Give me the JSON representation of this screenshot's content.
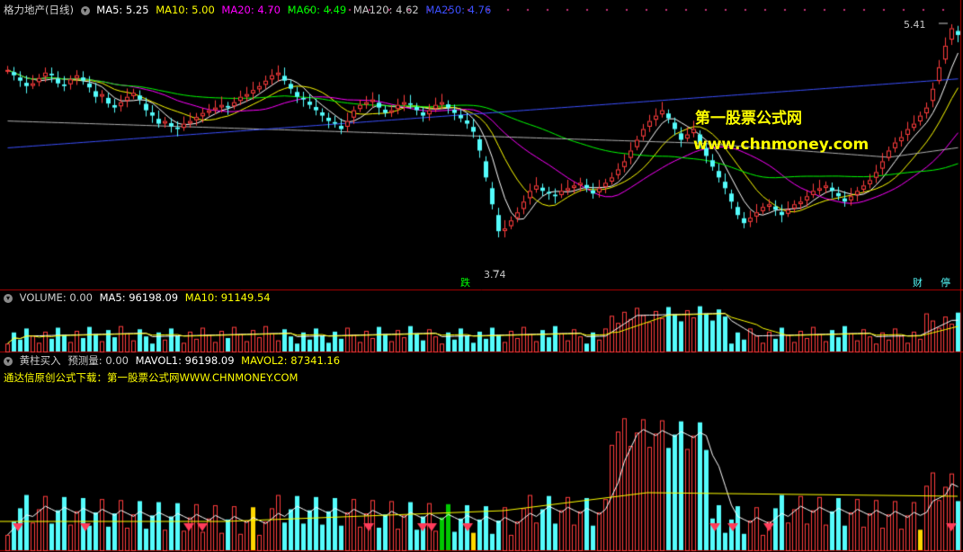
{
  "colors": {
    "up": "#ff3c3c",
    "down": "#54fcfc",
    "ma5": "#ffffff",
    "ma10": "#ffff00",
    "ma20": "#ff00ff",
    "ma60": "#00ff00",
    "ma120": "#b0b0b0",
    "ma250": "#3c50ff",
    "separator": "#b40000",
    "yellow_bar": "#ffd700",
    "green_bar": "#00c800"
  },
  "main_header": {
    "title": "格力地产(日线)",
    "ma5": "MA5: 5.25",
    "ma10": "MA10: 5.00",
    "ma20": "MA20: 4.70",
    "ma60": "MA60: 4.49",
    "ma120": "MA120: 4.62",
    "ma250": "MA250: 4.76"
  },
  "volume_header": {
    "title": "VOLUME: 0.00",
    "ma5": "MA5: 96198.09",
    "ma10": "MA10: 91149.54"
  },
  "ind_header": {
    "title": "黄柱买入",
    "forecast": "预测量: 0.00",
    "mavol1": "MAVOL1: 96198.09",
    "mavol2": "MAVOL2: 87341.16",
    "note": "通达信原创公式下载：第一股票公式网WWW.CHNMONEY.COM"
  },
  "watermark": {
    "line1": "第一股票公式网",
    "line2": "www.chnmoney.com"
  },
  "annotations": {
    "low_price": "3.74",
    "high_price": "5.41",
    "low_tag": "跌",
    "fin_tag": "财",
    "stop_tag": "停"
  },
  "chart_data": {
    "type": "candlestick",
    "ylim": [
      3.6,
      5.5
    ],
    "ma_labels": [
      "MA5",
      "MA10",
      "MA20",
      "MA60",
      "MA120",
      "MA250"
    ],
    "closes": [
      5.1,
      5.06,
      5.02,
      4.98,
      5.0,
      5.04,
      5.08,
      5.06,
      5.0,
      4.98,
      5.03,
      5.06,
      5.02,
      4.97,
      4.9,
      4.92,
      4.85,
      4.82,
      4.86,
      4.9,
      4.93,
      4.88,
      4.8,
      4.76,
      4.7,
      4.72,
      4.68,
      4.66,
      4.7,
      4.72,
      4.75,
      4.78,
      4.8,
      4.82,
      4.84,
      4.82,
      4.86,
      4.9,
      4.92,
      4.95,
      4.98,
      5.02,
      5.06,
      5.08,
      5.02,
      4.96,
      4.9,
      4.88,
      4.84,
      4.8,
      4.76,
      4.72,
      4.7,
      4.66,
      4.72,
      4.8,
      4.84,
      4.86,
      4.88,
      4.82,
      4.78,
      4.8,
      4.84,
      4.86,
      4.84,
      4.8,
      4.76,
      4.8,
      4.84,
      4.86,
      4.82,
      4.78,
      4.74,
      4.7,
      4.64,
      4.5,
      4.3,
      4.1,
      3.9,
      3.92,
      3.98,
      4.04,
      4.12,
      4.2,
      4.24,
      4.2,
      4.18,
      4.16,
      4.2,
      4.22,
      4.24,
      4.26,
      4.22,
      4.18,
      4.22,
      4.26,
      4.3,
      4.36,
      4.42,
      4.5,
      4.58,
      4.66,
      4.72,
      4.76,
      4.8,
      4.74,
      4.66,
      4.58,
      4.62,
      4.66,
      4.56,
      4.46,
      4.38,
      4.3,
      4.22,
      4.12,
      4.02,
      3.96,
      4.0,
      4.04,
      4.08,
      4.1,
      4.06,
      4.02,
      4.06,
      4.1,
      4.12,
      4.16,
      4.2,
      4.22,
      4.24,
      4.2,
      4.16,
      4.12,
      4.16,
      4.2,
      4.24,
      4.28,
      4.34,
      4.42,
      4.5,
      4.56,
      4.6,
      4.66,
      4.7,
      4.76,
      4.82,
      4.96,
      5.12,
      5.28,
      5.41,
      5.36
    ]
  }
}
